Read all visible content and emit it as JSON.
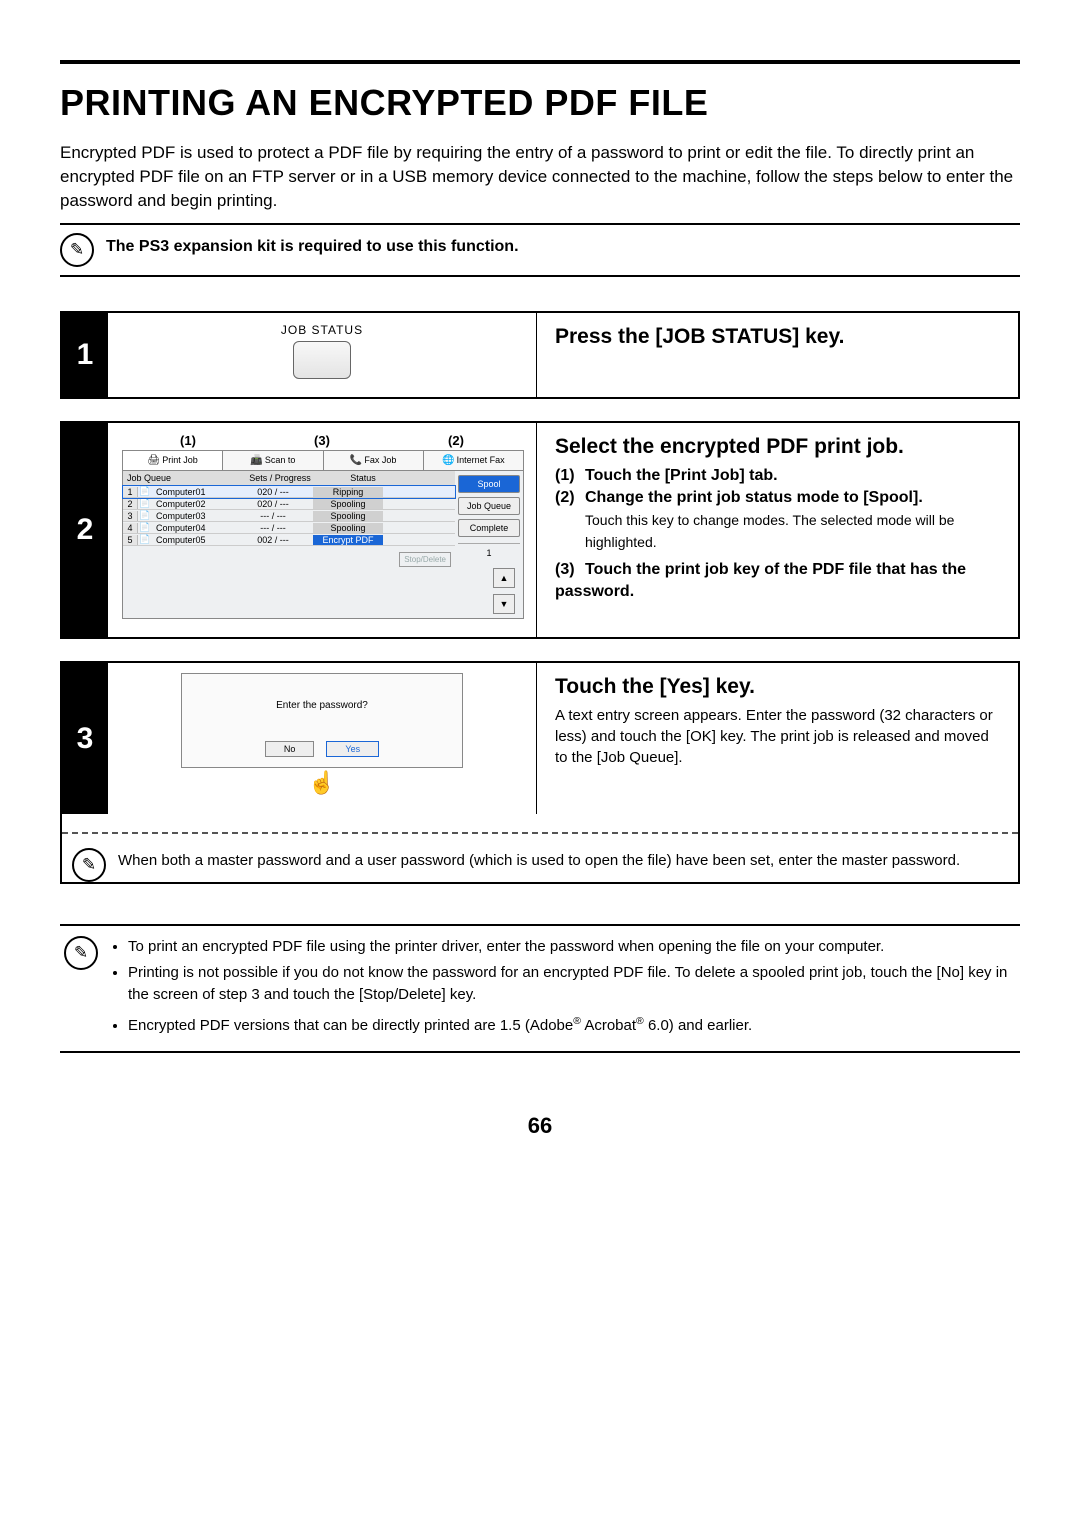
{
  "title": "PRINTING AN ENCRYPTED PDF FILE",
  "intro": "Encrypted PDF is used to protect a PDF file by requiring the entry of a password to print or edit the file. To directly print an encrypted PDF file on an FTP server or in a USB memory device connected to the machine, follow the steps below to enter the password and begin printing.",
  "top_note": "The PS3 expansion kit is required to use this function.",
  "step1": {
    "num": "1",
    "key_label": "JOB STATUS",
    "heading": "Press the [JOB STATUS] key."
  },
  "step2": {
    "num": "2",
    "callouts": {
      "c1": "(1)",
      "c2": "(3)",
      "c3": "(2)"
    },
    "tabs": {
      "t1": "Print Job",
      "t2": "Scan to",
      "t3": "Fax Job",
      "t4": "Internet Fax"
    },
    "cols": {
      "jobqueue": "Job Queue",
      "sets": "Sets / Progress",
      "status": "Status"
    },
    "rows": [
      {
        "i": "1",
        "name": "Computer01",
        "sets": "020 / ---",
        "status": "Ripping"
      },
      {
        "i": "2",
        "name": "Computer02",
        "sets": "020 / ---",
        "status": "Spooling"
      },
      {
        "i": "3",
        "name": "Computer03",
        "sets": "--- / ---",
        "status": "Spooling"
      },
      {
        "i": "4",
        "name": "Computer04",
        "sets": "--- / ---",
        "status": "Spooling"
      },
      {
        "i": "5",
        "name": "Computer05",
        "sets": "002 / ---",
        "status": "Encrypt PDF"
      }
    ],
    "modes": {
      "spool": "Spool",
      "jobqueue": "Job Queue",
      "complete": "Complete"
    },
    "pager": "1",
    "stopdel": "Stop/Delete",
    "heading": "Select the encrypted PDF print job.",
    "s1_n": "(1)",
    "s1_t": "Touch the [Print Job] tab.",
    "s2_n": "(2)",
    "s2_t": "Change the print job status mode to [Spool].",
    "s2_sub": "Touch this key to change modes. The selected mode will be highlighted.",
    "s3_n": "(3)",
    "s3_t": "Touch the print job key of the PDF file that has the password."
  },
  "step3": {
    "num": "3",
    "dialog_msg": "Enter the password?",
    "no": "No",
    "yes": "Yes",
    "heading": "Touch the [Yes] key.",
    "body": "A text entry screen appears. Enter the password (32 characters or less) and touch the [OK] key. The print job is released and moved to the [Job Queue].",
    "lower_note": "When both a master password and a user password (which is used to open the file) have been set, enter the master password."
  },
  "bottom_notes": {
    "n1": "To print an encrypted PDF file using the printer driver, enter the password when opening the file on your computer.",
    "n2": "Printing is not possible if you do not know the password for an encrypted PDF file. To delete a spooled print job, touch the [No] key in the screen of step 3 and touch the [Stop/Delete] key.",
    "n3_a": "Encrypted PDF versions that can be directly printed are 1.5 (Adobe",
    "n3_b": " Acrobat",
    "n3_c": " 6.0) and earlier."
  },
  "page_number": "66"
}
